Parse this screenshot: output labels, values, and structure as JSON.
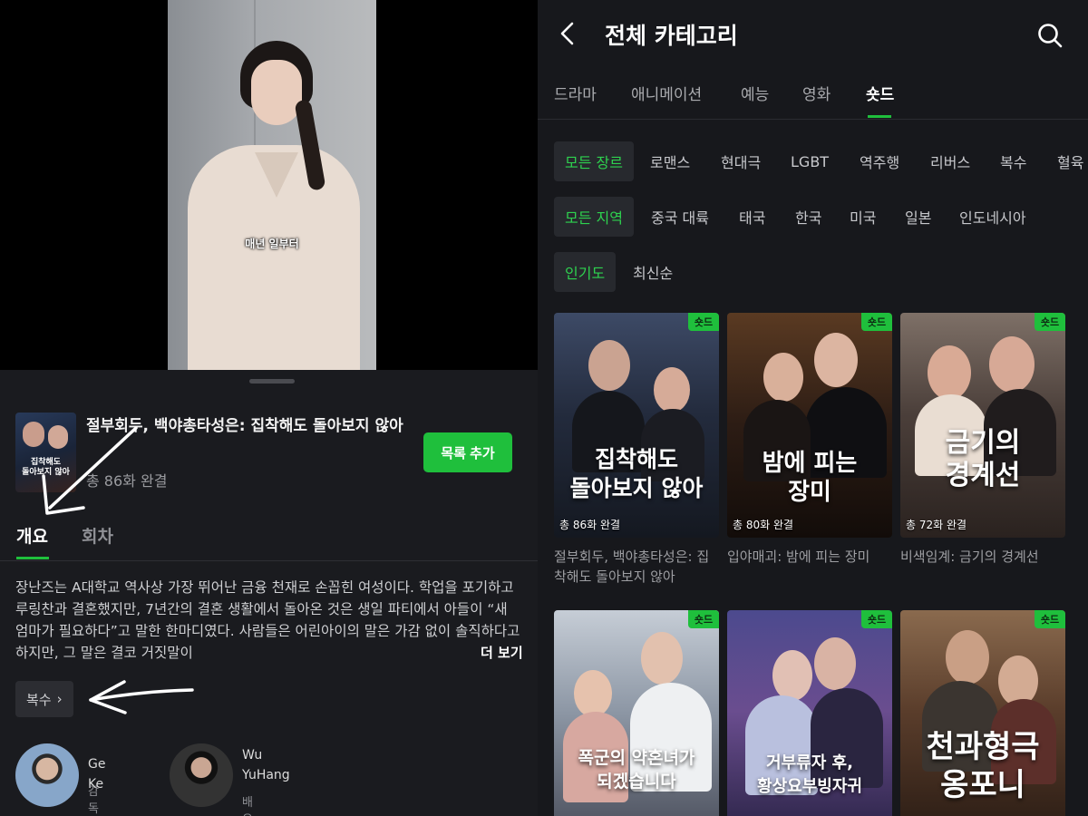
{
  "left": {
    "video": {
      "caption": "매년 일부터"
    },
    "show": {
      "thumb_text": "집착해도\n돌아보지 않아",
      "title": "절부회두, 백야총타성은: 집착해도 돌아보지 않아",
      "episode_count": "총 86화 완결",
      "add_button": "목록 추가"
    },
    "tabs": {
      "overview": "개요",
      "episodes": "회차"
    },
    "synopsis": "장난즈는 A대학교 역사상 가장 뛰어난 금융 천재로 손꼽힌 여성이다. 학업을 포기하고 루링찬과 결혼했지만, 7년간의 결혼 생활에서 돌아온 것은 생일 파티에서 아들이 “새 엄마가 필요하다”고 말한 한마디였다. 사람들은 어린아이의 말은 가감 없이 솔직하다고 하지만, 그 말은 결코 거짓말이",
    "more_label": "더 보기",
    "genre_chip": "복수",
    "genre_chevron": "›",
    "people": [
      {
        "name": "Ge Ke",
        "role": "감독"
      },
      {
        "name": "Wu YuHang",
        "role": "배우"
      }
    ],
    "colors": {
      "accent": "#1fbf3c",
      "background": "#1a1b1f"
    }
  },
  "right": {
    "title": "전체 카테고리",
    "icons": {
      "back": "chevron-left-icon",
      "search": "search-icon"
    },
    "category_tabs": [
      "드라마",
      "애니메이션",
      "예능",
      "영화",
      "숏드"
    ],
    "active_category": "숏드",
    "genre_filters": [
      "모든 장르",
      "로맨스",
      "현대극",
      "LGBT",
      "역주행",
      "리버스",
      "복수",
      "혈육"
    ],
    "region_filters": [
      "모든 지역",
      "중국 대륙",
      "태국",
      "한국",
      "미국",
      "일본",
      "인도네시아"
    ],
    "sort_filters": [
      "인기도",
      "최신순"
    ],
    "badge_label": "숏드",
    "cards": [
      {
        "poster_title": "집착해도\n돌아보지 않아",
        "episodes": "총 86화 완결",
        "name": "절부회두, 백야총타성은: 집착해도 돌아보지 않아"
      },
      {
        "poster_title": "밤에 피는\n장미",
        "episodes": "총 80화 완결",
        "name": "입야매괴: 밤에 피는 장미"
      },
      {
        "poster_title": "금기의\n경계선",
        "episodes": "총 72화 완결",
        "name": "비색임계: 금기의 경계선"
      },
      {
        "poster_title": "폭군의 약혼녀가\n되겠습니다",
        "episodes": "",
        "name": ""
      },
      {
        "poster_title": "거부류자 후,\n황상요부빙자귀",
        "episodes": "",
        "name": ""
      },
      {
        "poster_title": "천과형극\n옹포니",
        "episodes": "",
        "name": ""
      }
    ],
    "colors": {
      "accent": "#1fbf3c",
      "active_chip_text": "#2ed24f",
      "background": "#17181c"
    }
  }
}
